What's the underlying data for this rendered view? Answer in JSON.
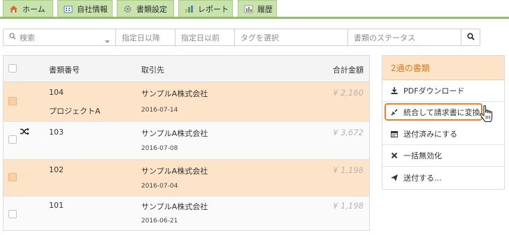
{
  "tabs": [
    {
      "label": "ホーム",
      "icon": "home-icon"
    },
    {
      "label": "自社情報",
      "icon": "building-icon"
    },
    {
      "label": "書類設定",
      "icon": "gear-icon"
    },
    {
      "label": "レポート",
      "icon": "bar-chart-icon"
    },
    {
      "label": "履歴",
      "icon": "history-chart-icon"
    }
  ],
  "search": {
    "keyword_placeholder": "検索",
    "date_from_placeholder": "指定日以降",
    "date_to_placeholder": "指定日以前",
    "tag_placeholder": "タグを選択",
    "status_placeholder": "書類のステータス"
  },
  "table": {
    "headers": {
      "number": "書類番号",
      "client": "取引先",
      "total": "合計金額"
    },
    "rows": [
      {
        "number": "104",
        "subject": "プロジェクトA",
        "client": "サンプルA株式会社",
        "date": "2016-07-14",
        "amount": "¥ 2,160",
        "selected": true,
        "merge_icon": false
      },
      {
        "number": "103",
        "subject": "",
        "client": "サンプルA株式会社",
        "date": "2016-07-08",
        "amount": "¥ 3,672",
        "selected": false,
        "merge_icon": true
      },
      {
        "number": "102",
        "subject": "",
        "client": "サンプルA株式会社",
        "date": "2016-07-04",
        "amount": "¥ 1,198",
        "selected": true,
        "merge_icon": false
      },
      {
        "number": "101",
        "subject": "",
        "client": "サンプルA株式会社",
        "date": "2016-06-21",
        "amount": "¥ 1,198",
        "selected": false,
        "merge_icon": false
      }
    ]
  },
  "panel": {
    "title": "2通の書類",
    "actions": [
      {
        "label": "PDFダウンロード",
        "icon": "download-icon"
      },
      {
        "label": "統合して請求書に変換",
        "icon": "merge-icon",
        "highlighted": true
      },
      {
        "label": "送付済みにする",
        "icon": "calendar-icon"
      },
      {
        "label": "一括無効化",
        "icon": "close-icon"
      },
      {
        "label": "送付する...",
        "icon": "send-icon"
      }
    ]
  },
  "colors": {
    "accent": "#f07f24",
    "selected_row": "#fde3c8",
    "tab_bg": "#c9e3ad",
    "tab_border": "#8fbd6a"
  }
}
